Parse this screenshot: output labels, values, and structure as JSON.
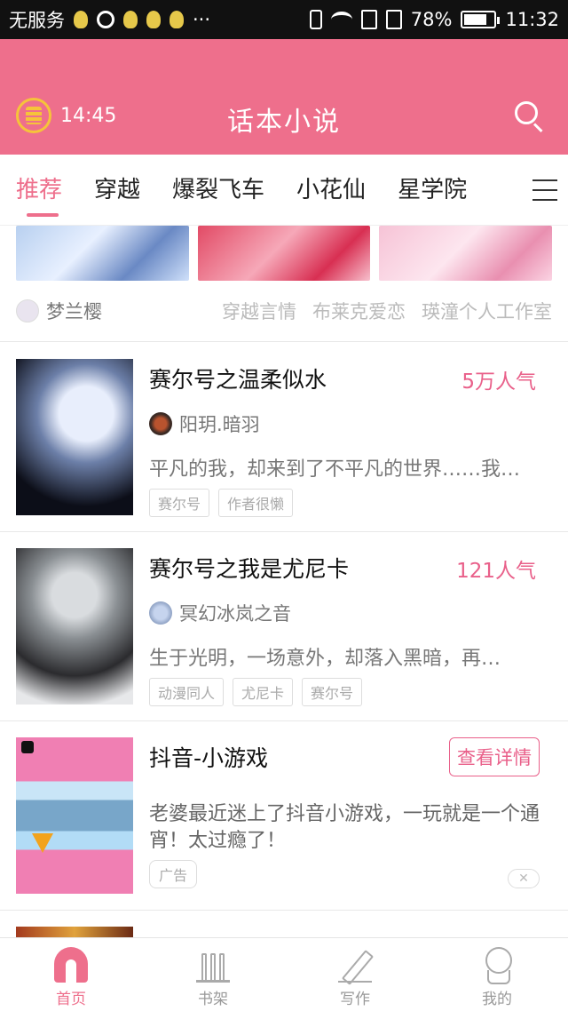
{
  "status_bar": {
    "carrier": "无服务",
    "dots": "···",
    "battery": "78%",
    "time": "11:32"
  },
  "header": {
    "timer": "14:45",
    "title": "话本小说"
  },
  "tabs": [
    "推荐",
    "穿越",
    "爆裂飞车",
    "小花仙",
    "星学院"
  ],
  "authors_row": {
    "first": "梦兰樱",
    "others": [
      "穿越言情",
      "布莱克爱恋",
      "瑛潼个人工作室"
    ]
  },
  "stories": [
    {
      "title": "赛尔号之温柔似水",
      "popularity": "5万人气",
      "author": "阳玥.暗羽",
      "desc": "平凡的我，却来到了不平凡的世界……我…",
      "tags": [
        "赛尔号",
        "作者很懒"
      ]
    },
    {
      "title": "赛尔号之我是尤尼卡",
      "popularity": "121人气",
      "author": "冥幻冰岚之音",
      "desc": "生于光明，一场意外，却落入黑暗，再…",
      "tags": [
        "动漫同人",
        "尤尼卡",
        "赛尔号"
      ]
    }
  ],
  "ad": {
    "title": "抖音-小游戏",
    "button": "查看详情",
    "desc": "老婆最近迷上了抖音小游戏，一玩就是一个通宵！太过瘾了！",
    "tag": "广告",
    "close": "✕"
  },
  "bottom_nav": [
    "首页",
    "书架",
    "写作",
    "我的"
  ],
  "colors": {
    "accent": "#ee6f8c",
    "popularity": "#e9608a"
  }
}
